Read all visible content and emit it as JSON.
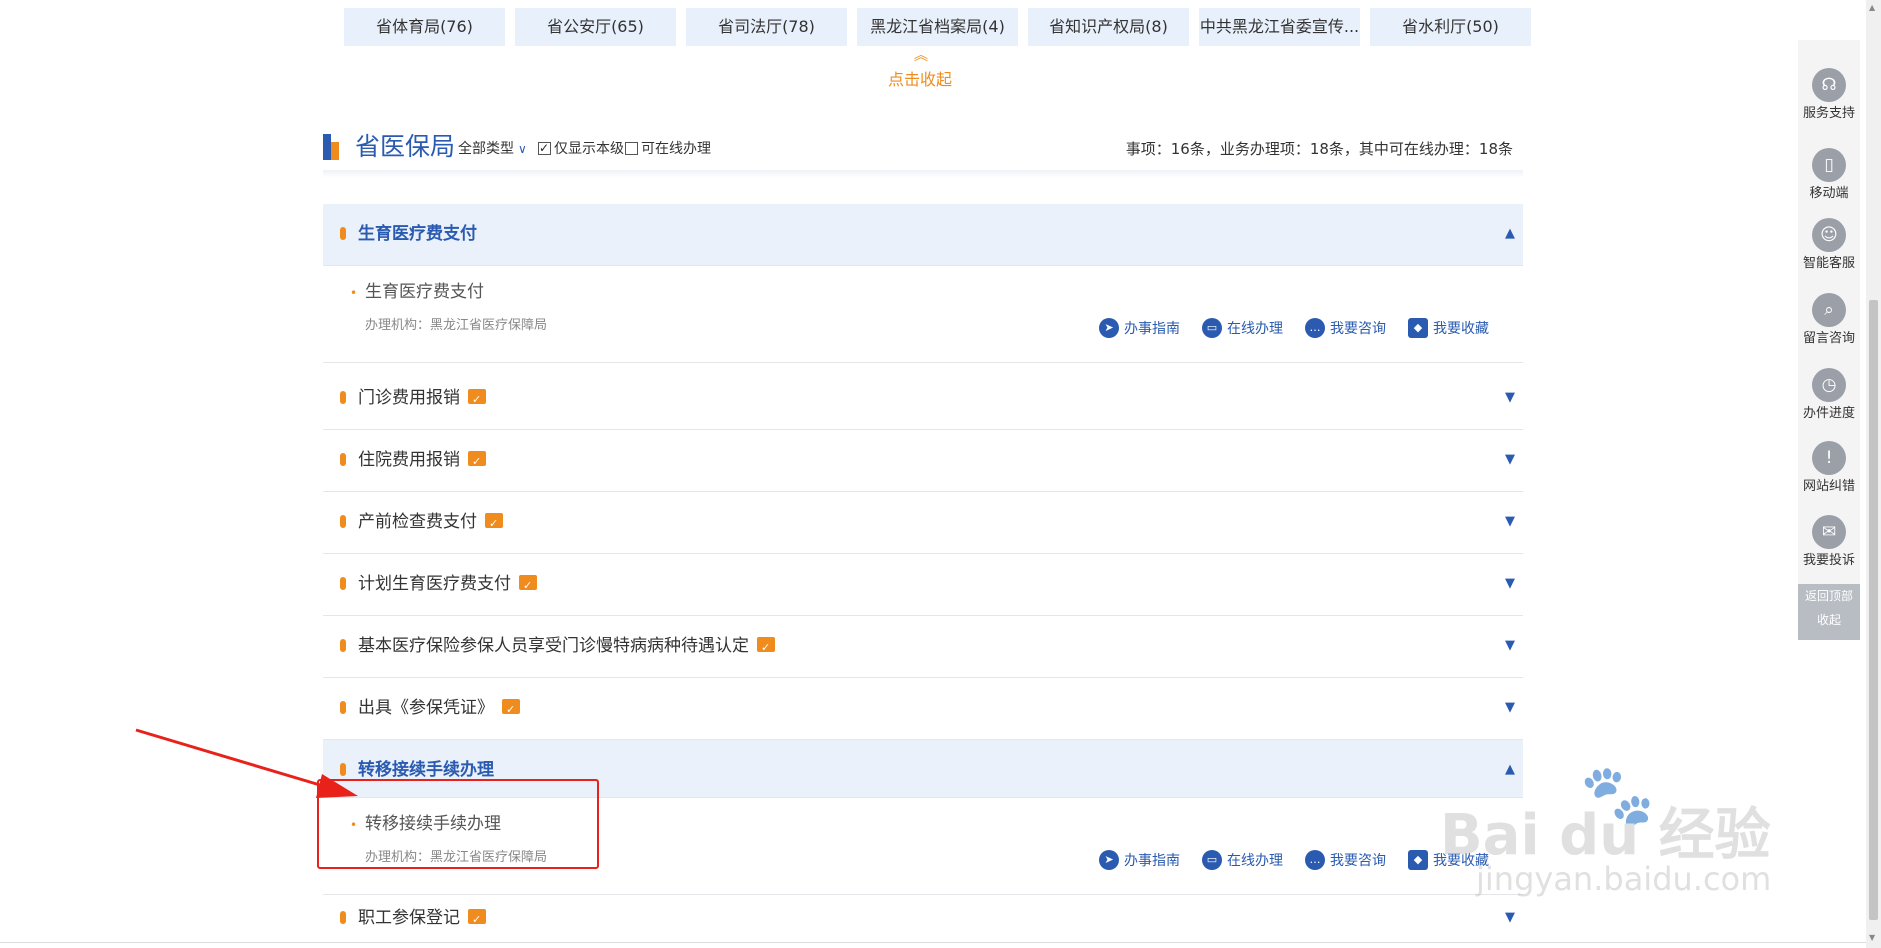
{
  "dept_tabs": [
    "省体育局(76)",
    "省公安厅(65)",
    "省司法厅(78)",
    "黑龙江省档案局(4)",
    "省知识产权局(8)",
    "中共黑龙江省委宣传...",
    "省水利厅(50)"
  ],
  "collapse_label": "点击收起",
  "section": {
    "title": "省医保局",
    "type_filter": "全部类型",
    "only_this_level": "仅显示本级",
    "online_only": "可在线办理",
    "stats": "事项：16条，业务办理项：18条，其中可在线办理：18条"
  },
  "rows": [
    {
      "title": "生育医疗费支付",
      "expanded": true,
      "online": false
    },
    {
      "title": "门诊费用报销",
      "expanded": false,
      "online": true
    },
    {
      "title": "住院费用报销",
      "expanded": false,
      "online": true
    },
    {
      "title": "产前检查费支付",
      "expanded": false,
      "online": true
    },
    {
      "title": "计划生育医疗费支付",
      "expanded": false,
      "online": true
    },
    {
      "title": "基本医疗保险参保人员享受门诊慢特病病种待遇认定",
      "expanded": false,
      "online": true
    },
    {
      "title": "出具《参保凭证》",
      "expanded": false,
      "online": true
    },
    {
      "title": "转移接续手续办理",
      "expanded": true,
      "online": false
    },
    {
      "title": "职工参保登记",
      "expanded": false,
      "online": true
    }
  ],
  "details": [
    {
      "title": "生育医疗费支付",
      "org": "办理机构：黑龙江省医疗保障局"
    },
    {
      "title": "转移接续手续办理",
      "org": "办理机构：黑龙江省医疗保障局"
    }
  ],
  "actions": {
    "guide": "办事指南",
    "online": "在线办理",
    "consult": "我要咨询",
    "favorite": "我要收藏"
  },
  "sidebar": {
    "items": [
      "服务支持",
      "移动端",
      "智能客服",
      "留言咨询",
      "办件进度",
      "网站纠错",
      "我要投诉"
    ],
    "back_top": "返回顶部",
    "collapse": "收起"
  },
  "watermark": {
    "main": "Bai du 经验",
    "url": "jingyan.baidu.com"
  },
  "colors": {
    "accent": "#2a5bb0",
    "orange": "#f08c1e",
    "annotation": "#e8221b"
  }
}
